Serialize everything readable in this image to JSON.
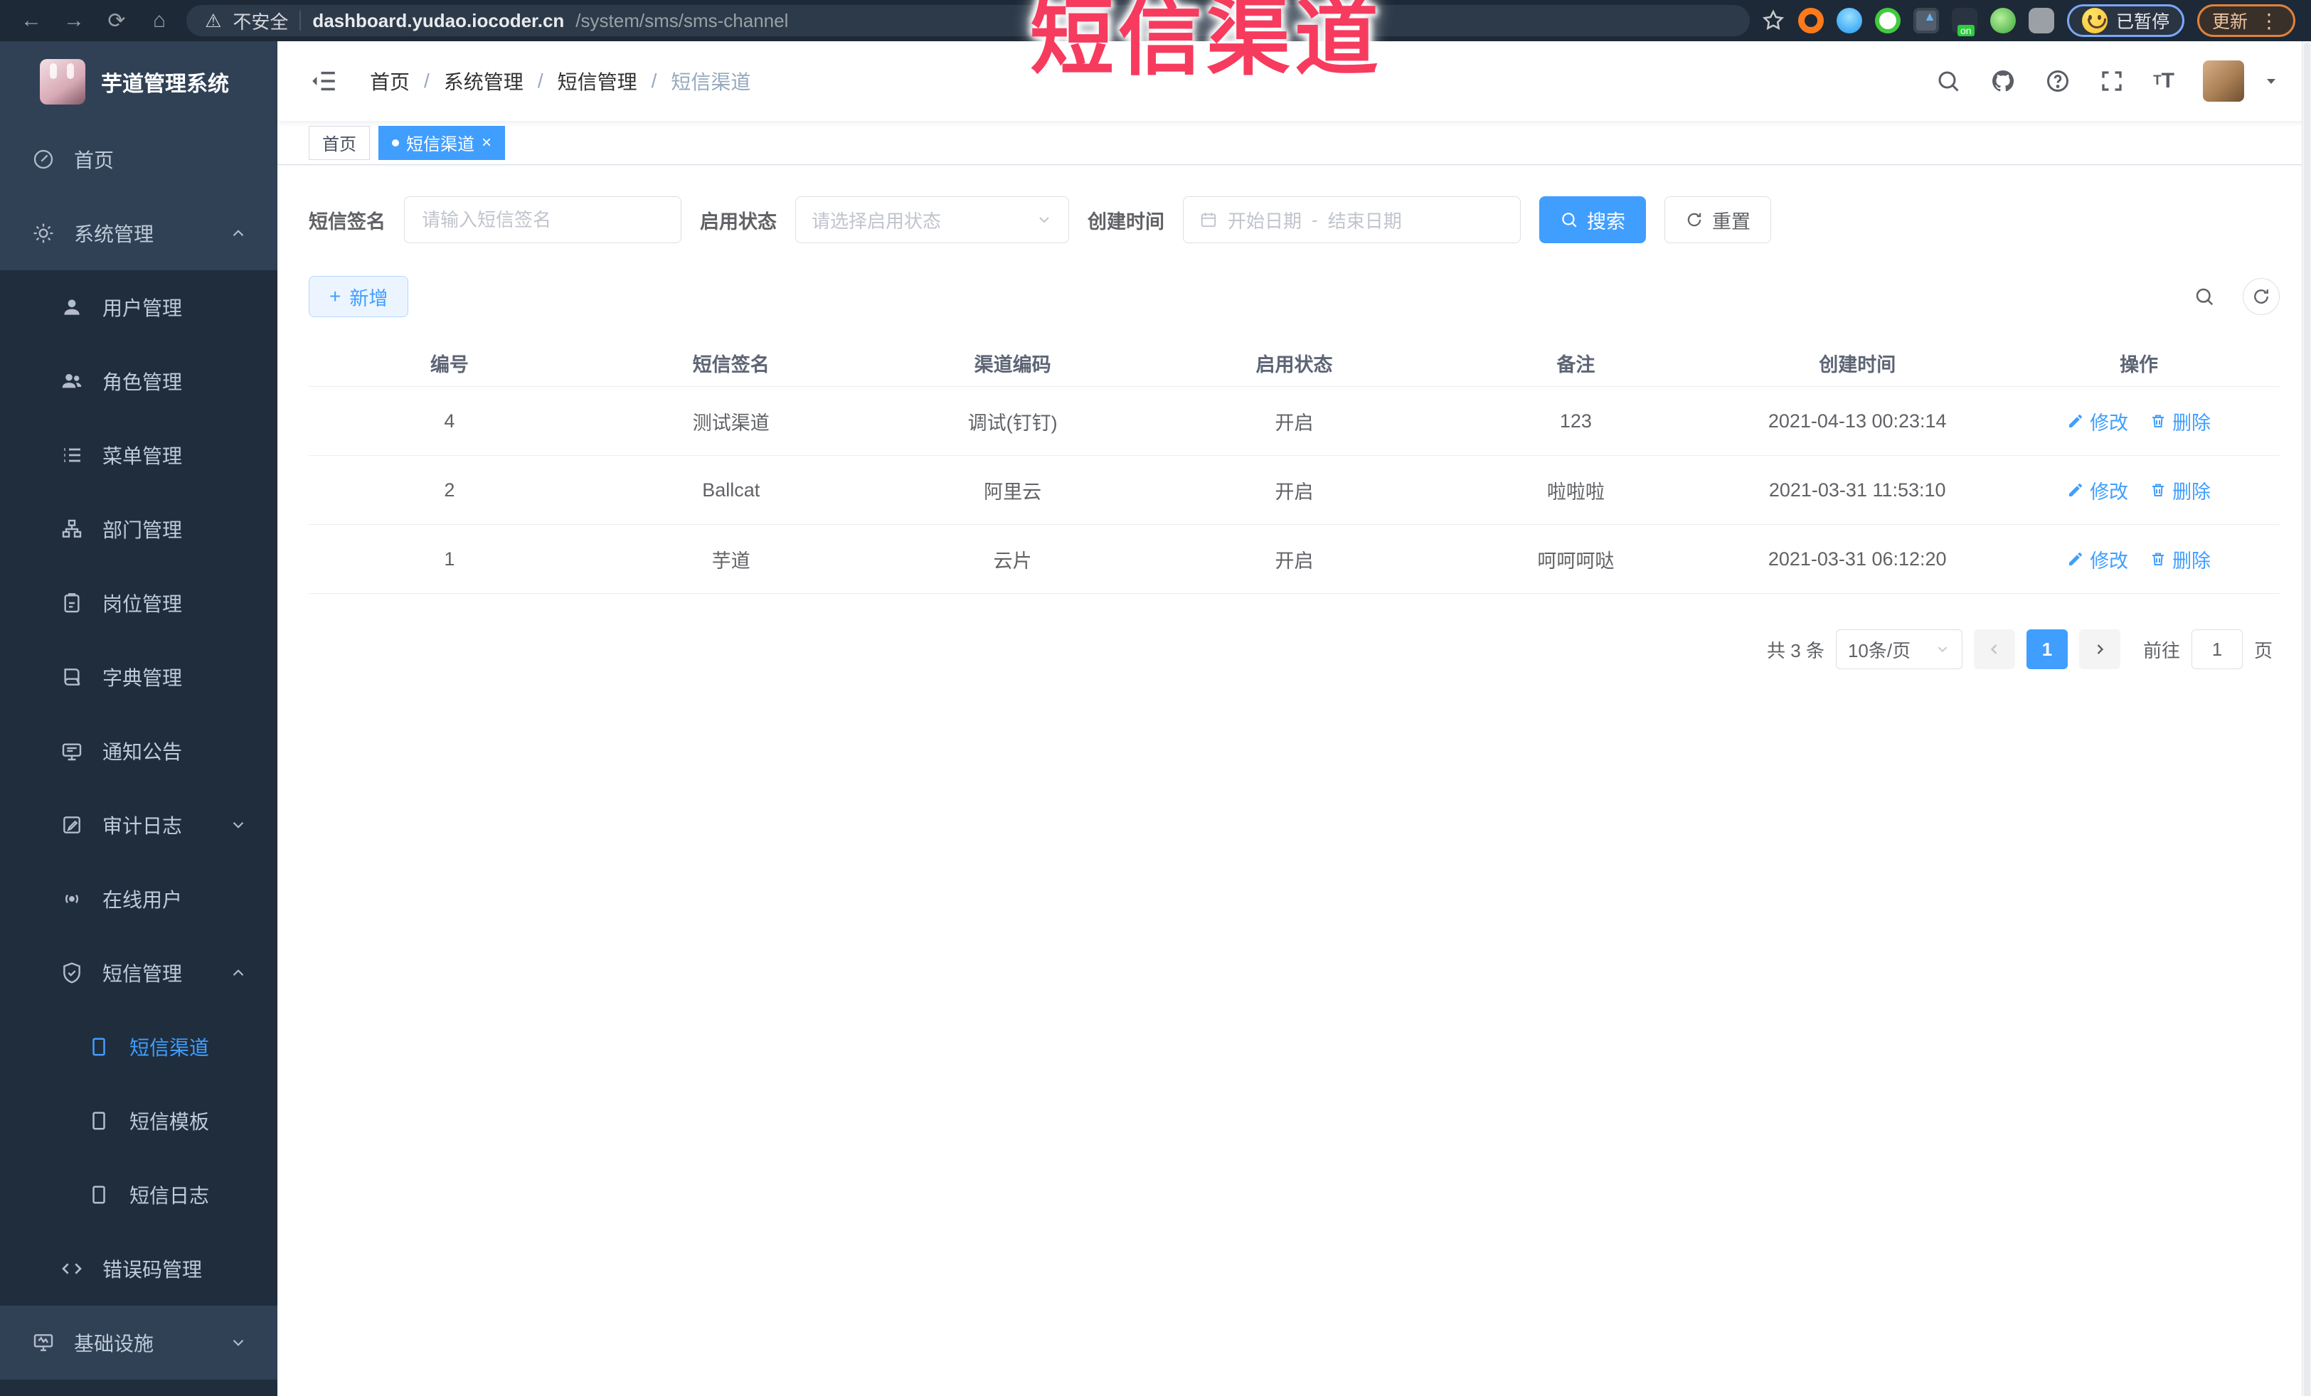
{
  "browser": {
    "security_label": "不安全",
    "url_host": "dashboard.yudao.iocoder.cn",
    "url_path": "/system/sms/sms-channel",
    "extension_badge": "on",
    "profile_label": "已暂停",
    "update_label": "更新",
    "more_glyph": "⋮"
  },
  "overlay": {
    "title": "短信渠道"
  },
  "sidebar": {
    "logo_title": "芋道管理系统",
    "items": [
      {
        "label": "首页"
      },
      {
        "label": "系统管理"
      },
      {
        "label": "用户管理"
      },
      {
        "label": "角色管理"
      },
      {
        "label": "菜单管理"
      },
      {
        "label": "部门管理"
      },
      {
        "label": "岗位管理"
      },
      {
        "label": "字典管理"
      },
      {
        "label": "通知公告"
      },
      {
        "label": "审计日志"
      },
      {
        "label": "在线用户"
      },
      {
        "label": "短信管理"
      },
      {
        "label": "短信渠道"
      },
      {
        "label": "短信模板"
      },
      {
        "label": "短信日志"
      },
      {
        "label": "错误码管理"
      },
      {
        "label": "基础设施"
      }
    ]
  },
  "header": {
    "breadcrumb": [
      "首页",
      "系统管理",
      "短信管理",
      "短信渠道"
    ],
    "separator": "/"
  },
  "tabs": [
    {
      "label": "首页"
    },
    {
      "label": "短信渠道"
    }
  ],
  "filters": {
    "sign_label": "短信签名",
    "sign_placeholder": "请输入短信签名",
    "status_label": "启用状态",
    "status_placeholder": "请选择启用状态",
    "time_label": "创建时间",
    "start_placeholder": "开始日期",
    "range_separator": "-",
    "end_placeholder": "结束日期",
    "search_label": "搜索",
    "reset_label": "重置"
  },
  "toolbar": {
    "add_label": "新增"
  },
  "table": {
    "columns": [
      "编号",
      "短信签名",
      "渠道编码",
      "启用状态",
      "备注",
      "创建时间",
      "操作"
    ],
    "rows": [
      [
        "4",
        "测试渠道",
        "调试(钉钉)",
        "开启",
        "123",
        "2021-04-13 00:23:14"
      ],
      [
        "2",
        "Ballcat",
        "阿里云",
        "开启",
        "啦啦啦",
        "2021-03-31 11:53:10"
      ],
      [
        "1",
        "芋道",
        "云片",
        "开启",
        "呵呵呵哒",
        "2021-03-31 06:12:20"
      ]
    ],
    "edit_label": "修改",
    "delete_label": "删除"
  },
  "pagination": {
    "total": "共 3 条",
    "page_size": "10条/页",
    "page": "1",
    "goto_label": "前往",
    "goto_value": "1",
    "page_suffix": "页"
  },
  "colors": {
    "accent": "#409eff",
    "overlay_red": "#f63b5e",
    "sidebar_bg": "#304156",
    "sidebar_sub_bg": "#1f2d3d"
  }
}
